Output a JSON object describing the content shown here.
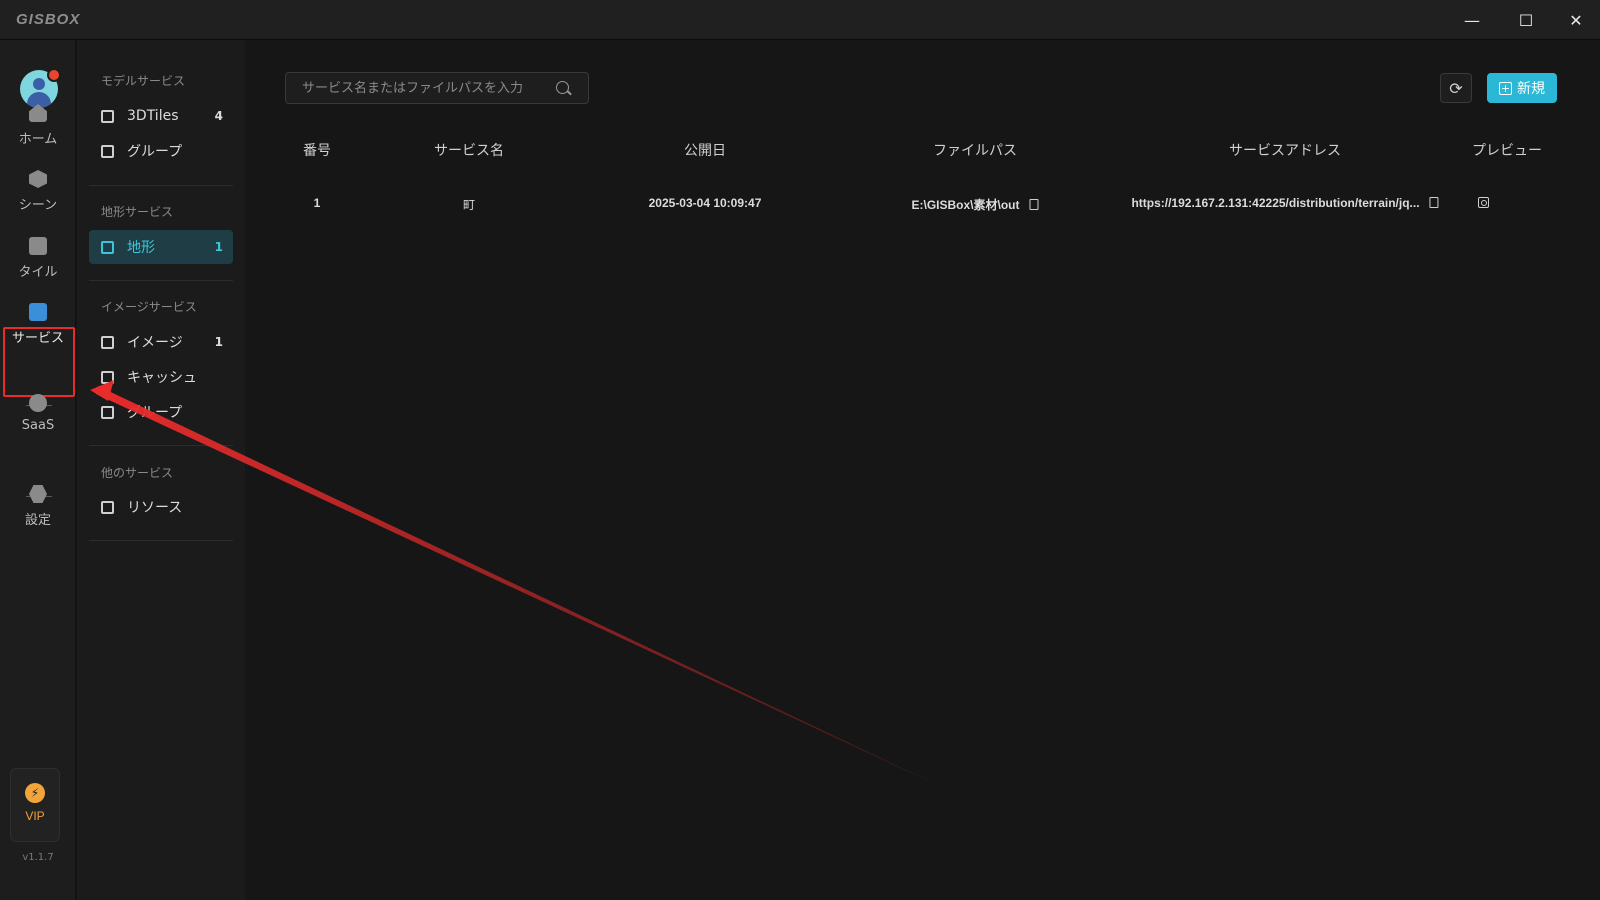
{
  "app": {
    "logo": "GISBOX",
    "window_controls": {
      "minimize": "—",
      "maximize": "☐",
      "close": "✕"
    }
  },
  "rail": {
    "items": [
      {
        "label": "ホーム"
      },
      {
        "label": "シーン"
      },
      {
        "label": "タイル"
      },
      {
        "label": "サービス"
      },
      {
        "label": "SaaS"
      },
      {
        "label": "設定"
      }
    ],
    "vip_label": "VIP",
    "version": "v1.1.7"
  },
  "subnav": {
    "groups": [
      {
        "title": "モデルサービス",
        "items": [
          {
            "label": "3DTiles",
            "count": "4"
          },
          {
            "label": "グループ",
            "count": ""
          }
        ]
      },
      {
        "title": "地形サービス",
        "items": [
          {
            "label": "地形",
            "count": "1"
          }
        ]
      },
      {
        "title": "イメージサービス",
        "items": [
          {
            "label": "イメージ",
            "count": "1"
          },
          {
            "label": "キャッシュ",
            "count": ""
          },
          {
            "label": "グループ",
            "count": ""
          }
        ]
      },
      {
        "title": "他のサービス",
        "items": [
          {
            "label": "リソース",
            "count": ""
          }
        ]
      }
    ]
  },
  "main": {
    "search_placeholder": "サービス名またはファイルパスを入力",
    "refresh_icon": "⟳",
    "new_button": "新規",
    "columns": [
      "番号",
      "サービス名",
      "公開日",
      "ファイルパス",
      "サービスアドレス",
      "プレビュー"
    ],
    "rows": [
      {
        "number": "1",
        "name": "町",
        "date": "2025-03-04 10:09:47",
        "path": "E:\\GISBox\\素材\\out",
        "address": "https://192.167.2.131:42225/distribution/terrain/jq..."
      }
    ]
  },
  "colors": {
    "accent": "#2bb8d6",
    "highlight_box": "#e82b2b",
    "vip": "#f0a43a"
  }
}
